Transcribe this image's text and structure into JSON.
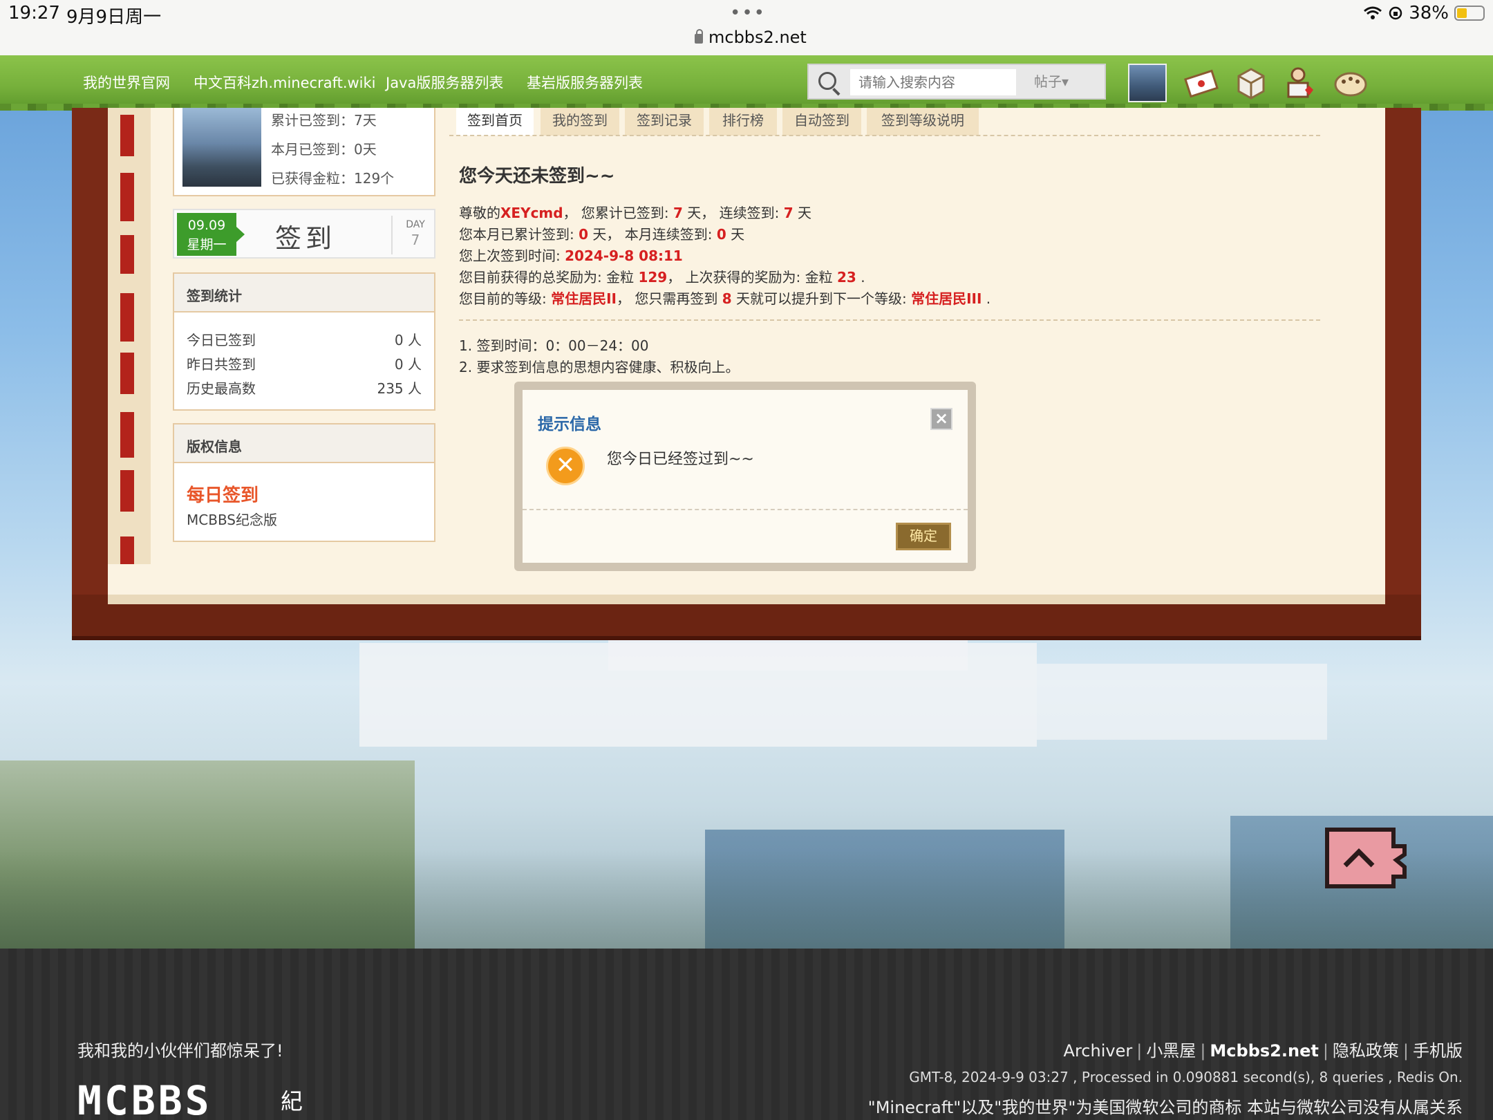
{
  "status_bar": {
    "time": "19:27",
    "date": "9月9日周一",
    "dots": "•••",
    "url": "mcbbs2.net",
    "battery": "38%"
  },
  "nav": {
    "links": [
      "我的世界官网",
      "中文百科zh.minecraft.wiki",
      "Java版服务器列表",
      "基岩版服务器列表"
    ],
    "search_placeholder": "请输入搜索内容",
    "search_type": "帖子▾"
  },
  "profile": {
    "total_signed": "累计已签到：7天",
    "month_signed": "本月已签到：0天",
    "gold": "已获得金粒：129个"
  },
  "sign_widget": {
    "date": "09.09",
    "weekday": "星期一",
    "label": "签到",
    "day_label": "DAY",
    "day_num": "7"
  },
  "stats": {
    "title": "签到统计",
    "rows": [
      {
        "label": "今日已签到",
        "value": "0 人"
      },
      {
        "label": "昨日共签到",
        "value": "0 人"
      },
      {
        "label": "历史最高数",
        "value": "235 人"
      }
    ]
  },
  "copyright": {
    "title": "版权信息",
    "name": "每日签到",
    "sub": "MCBBS纪念版"
  },
  "tabs": [
    "签到首页",
    "我的签到",
    "签到记录",
    "排行榜",
    "自动签到",
    "签到等级说明"
  ],
  "content": {
    "heading": "您今天还未签到~~",
    "line1": {
      "a": "尊敬的",
      "user": "XEYcmd",
      "b": "， 您累计已签到: ",
      "total": "7",
      "c": " 天， 连续签到: ",
      "streak": "7",
      "d": " 天"
    },
    "line2": {
      "a": "您本月已累计签到: ",
      "month": "0",
      "b": " 天， 本月连续签到: ",
      "month_streak": "0",
      "c": " 天"
    },
    "line3": {
      "a": "您上次签到时间: ",
      "time": "2024-9-8 08:11"
    },
    "line4": {
      "a": "您目前获得的总奖励为: 金粒 ",
      "total": "129",
      "b": "， 上次获得的奖励为: 金粒 ",
      "last": "23",
      "c": " ."
    },
    "line5": {
      "a": "您目前的等级: ",
      "level": "常住居民II",
      "b": "， 您只需再签到 ",
      "days": "8",
      "c": " 天就可以提升到下一个等级: ",
      "next": "常住居民III",
      "d": " ."
    },
    "rules": [
      "1.  签到时间：0：00－24：00",
      "2.  要求签到信息的思想内容健康、积极向上。"
    ]
  },
  "dialog": {
    "title": "提示信息",
    "close": "×",
    "message": "您今日已经签过到~~",
    "ok": "确定"
  },
  "footer": {
    "slogan": "我和我的小伙伴们都惊呆了!",
    "logo": "MCBBS",
    "logo_sub": "紀",
    "links": [
      "Archiver",
      "小黑屋",
      "Mcbbs2.net",
      "隐私政策",
      "手机版"
    ],
    "meta": "GMT-8, 2024-9-9 03:27 , Processed in 0.090881 second(s), 8 queries , Redis On.",
    "legal": "\"Minecraft\"以及\"我的世界\"为美国微软公司的商标 本站与微软公司没有从属关系"
  }
}
